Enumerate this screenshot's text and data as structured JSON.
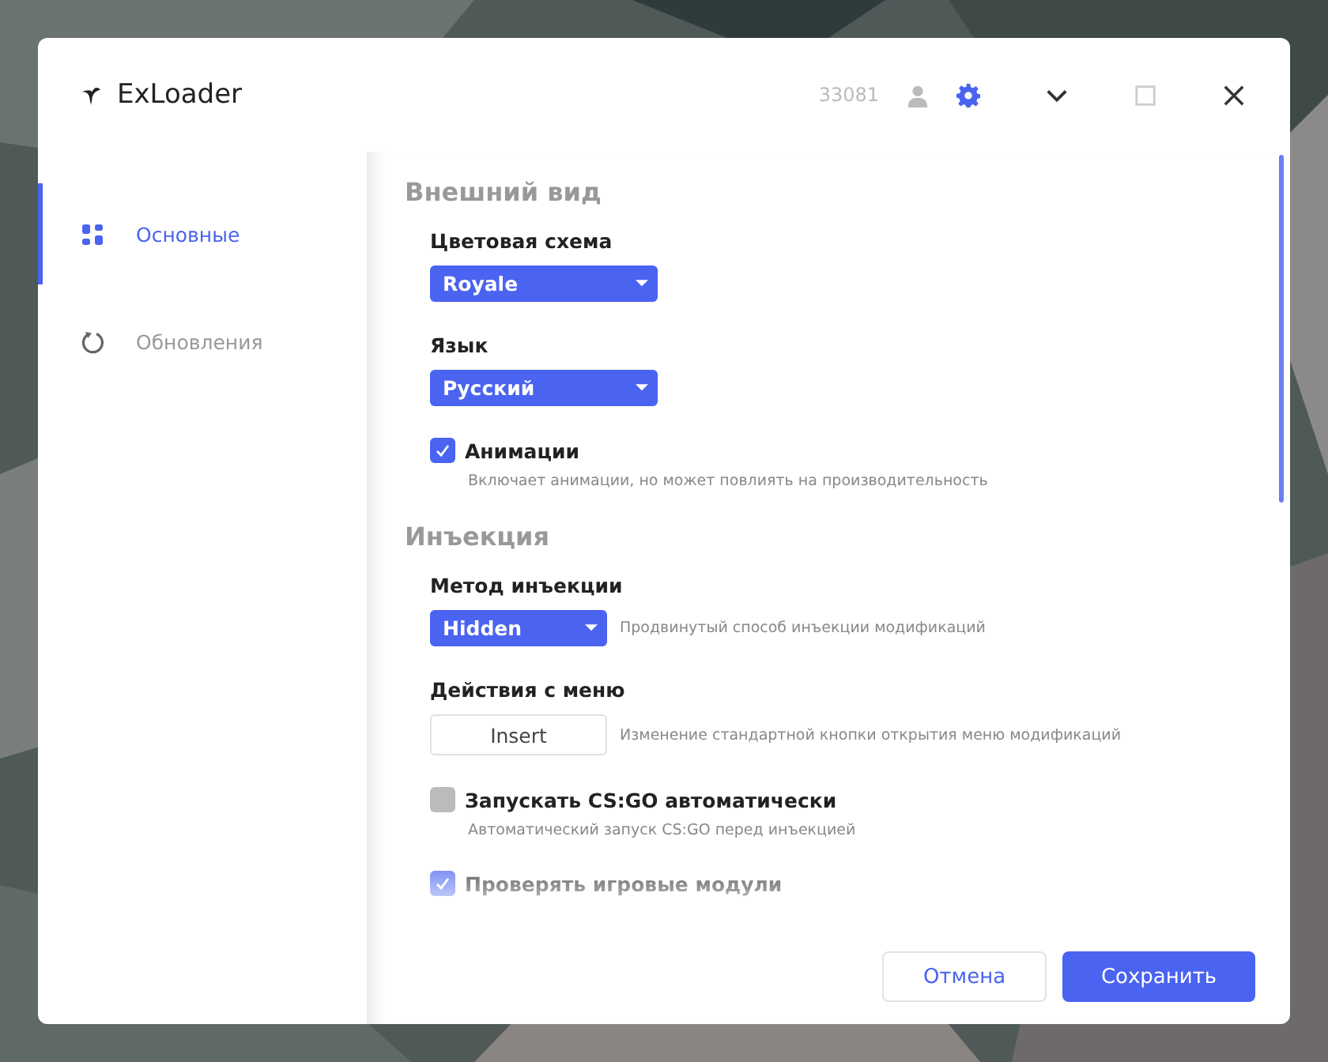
{
  "window": {
    "title": "ExLoader",
    "user_id": "33081"
  },
  "sidebar": {
    "items": [
      {
        "label": "Основные",
        "kind": "grid",
        "selected": true
      },
      {
        "label": "Обновления",
        "kind": "refresh",
        "selected": false
      }
    ]
  },
  "sections": [
    {
      "title": "Внешний вид",
      "items": [
        {
          "kind": "select",
          "label": "Цветовая схема",
          "value": "Royale"
        },
        {
          "kind": "select",
          "label": "Язык",
          "value": "Русский"
        },
        {
          "kind": "checkbox",
          "label": "Анимации",
          "checked": true,
          "note": "Включает анимации, но может повлиять на производительность"
        }
      ]
    },
    {
      "title": "Инъекция",
      "items": [
        {
          "kind": "select",
          "label": "Метод инъекции",
          "value": "Hidden",
          "note": "Продвинутый способ инъекции модификаций"
        },
        {
          "kind": "key",
          "label": "Действия с меню",
          "value": "Insert",
          "note": "Изменение стандартной кнопки открытия меню модификаций"
        },
        {
          "kind": "checkbox",
          "label": "Запускать CS:GO автоматически",
          "checked": false,
          "note": "Автоматический запуск CS:GO перед инъекцией"
        },
        {
          "kind": "checkbox",
          "label": "Проверять игровые модули",
          "checked": true
        }
      ]
    }
  ],
  "buttons": [
    {
      "label": "Отмена",
      "kind": "secondary"
    },
    {
      "label": "Сохранить",
      "kind": "primary"
    }
  ]
}
